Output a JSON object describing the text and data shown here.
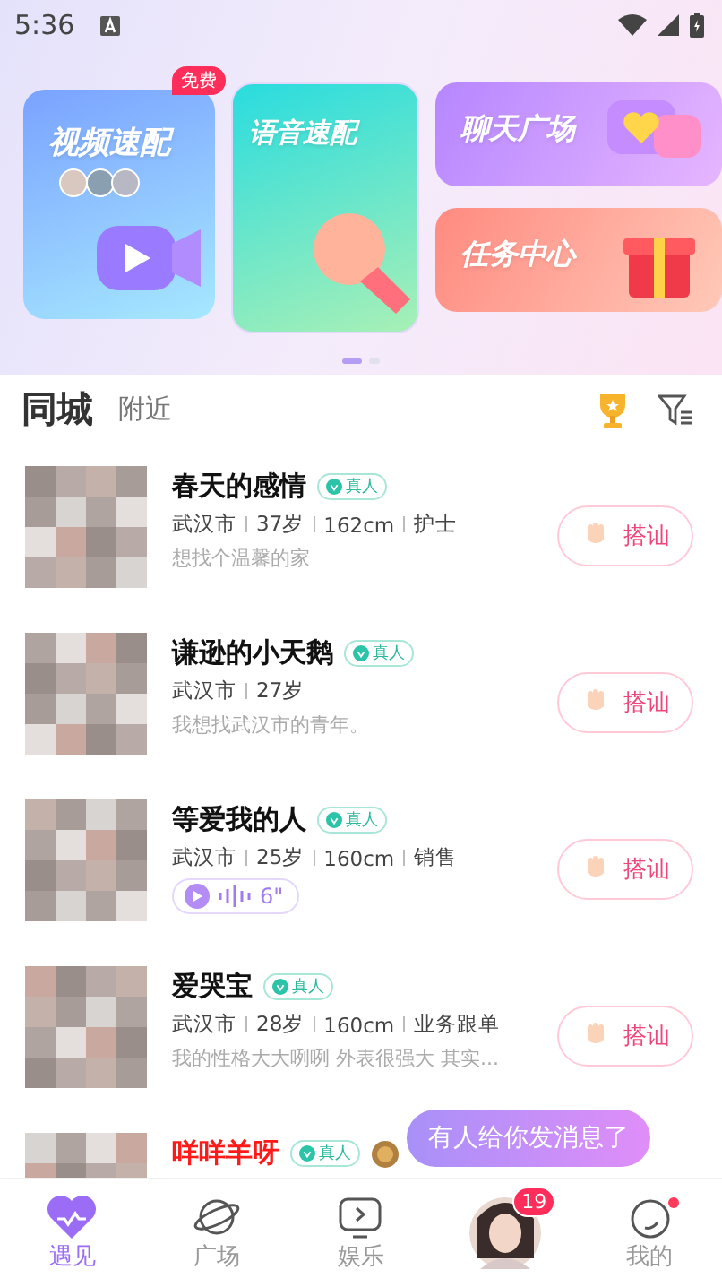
{
  "status_bar": {
    "time": "5:36"
  },
  "banners": [
    {
      "kind": "video",
      "title": "视频速配",
      "badge": "免费"
    },
    {
      "kind": "voice",
      "title": "语音速配"
    },
    {
      "kind": "chat",
      "title": "聊天广场"
    },
    {
      "kind": "task",
      "title": "任务中心"
    }
  ],
  "banner_pager": [
    {
      "selected": true
    },
    {
      "selected": false
    }
  ],
  "tabs": [
    {
      "label": "同城",
      "selected": true
    },
    {
      "label": "附近",
      "selected": false
    }
  ],
  "users": [
    {
      "name": "春天的感情",
      "vip": false,
      "verified": "真人",
      "info": [
        "武汉市",
        "37岁",
        "162cm",
        "护士"
      ],
      "desc": "想找个温馨的家",
      "action": "搭讪"
    },
    {
      "name": "谦逊的小天鹅",
      "vip": false,
      "verified": "真人",
      "info": [
        "武汉市",
        "27岁"
      ],
      "desc": "我想找武汉市的青年。",
      "action": "搭讪"
    },
    {
      "name": "等爱我的人",
      "vip": false,
      "verified": "真人",
      "info": [
        "武汉市",
        "25岁",
        "160cm",
        "销售"
      ],
      "voice": "6\"",
      "action": "搭讪"
    },
    {
      "name": "爱哭宝",
      "vip": false,
      "verified": "真人",
      "info": [
        "武汉市",
        "28岁",
        "160cm",
        "业务跟单"
      ],
      "desc": "我的性格大大咧咧 外表很强大 其实...",
      "action": "搭讪"
    },
    {
      "name": "咩咩羊呀",
      "vip": true,
      "verified": "真人"
    }
  ],
  "toast": "有人给你发消息了",
  "nav": [
    {
      "kind": "heart",
      "label": "遇见",
      "selected": true
    },
    {
      "kind": "planet",
      "label": "广场",
      "selected": false
    },
    {
      "kind": "tv",
      "label": "娱乐",
      "selected": false
    },
    {
      "kind": "avatar",
      "badge": "19",
      "selected": false
    },
    {
      "kind": "me",
      "label": "我的",
      "selected": false,
      "dot": true
    }
  ]
}
